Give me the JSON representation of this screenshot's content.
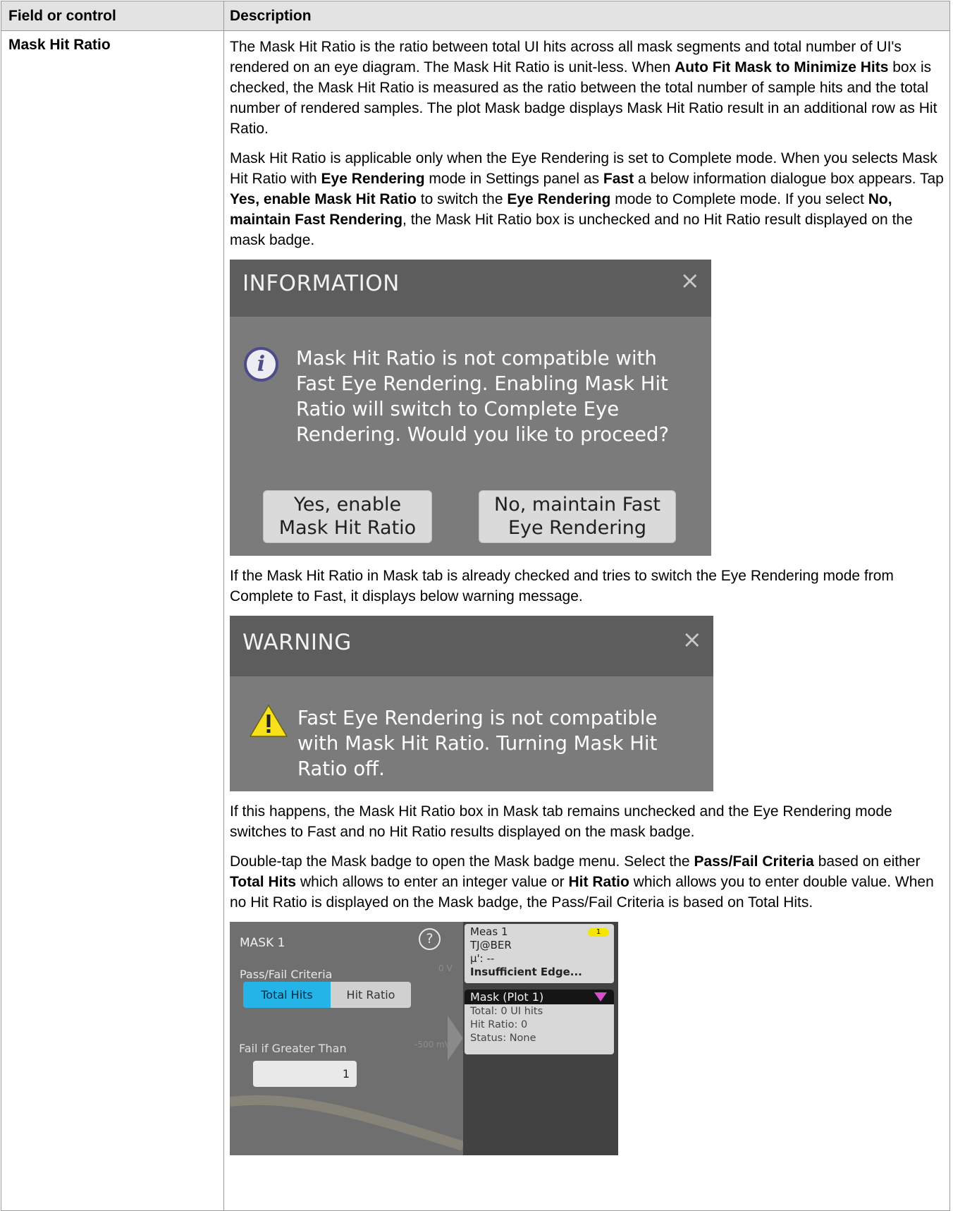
{
  "table": {
    "header_field": "Field or control",
    "header_description": "Description"
  },
  "row": {
    "field": "Mask Hit Ratio",
    "para1": {
      "t1": "The Mask Hit Ratio is the ratio between total UI hits across all mask segments and total number of UI's rendered on an eye diagram. The Mask Hit Ratio is unit-less. When ",
      "b1": "Auto Fit Mask to Minimize Hits",
      "t2": " box is checked, the Mask Hit Ratio is measured as the ratio between the total number of sample hits and the total number of rendered samples. The plot Mask badge displays Mask Hit Ratio result in an additional row as Hit Ratio."
    },
    "para2": {
      "t1": "Mask Hit Ratio is applicable only when the Eye Rendering is set to Complete mode. When you selects Mask Hit Ratio with ",
      "b1": "Eye Rendering",
      "t2": " mode in Settings panel as ",
      "b2": "Fast",
      "t3": " a below information dialogue box appears. Tap ",
      "b3": "Yes, enable Mask Hit Ratio",
      "t4": " to switch the ",
      "b4": "Eye Rendering",
      "t5": " mode to Complete mode. If you select ",
      "b5": "No, maintain Fast Rendering",
      "t6": ", the Mask Hit Ratio box is unchecked and no Hit Ratio result displayed on the mask badge."
    },
    "info_dialog": {
      "title": "INFORMATION",
      "close": "×",
      "icon": "info-icon",
      "message": "Mask Hit Ratio is not compatible with Fast Eye Rendering. Enabling Mask Hit Ratio will switch to Complete Eye Rendering. Would you like to proceed?",
      "yes_line1": "Yes, enable",
      "yes_line2": "Mask Hit Ratio",
      "no_line1": "No, maintain Fast",
      "no_line2": "Eye Rendering"
    },
    "para3": "If the Mask Hit Ratio in Mask tab is already checked and tries to switch the Eye Rendering mode from Complete to Fast, it displays below warning message.",
    "warning_dialog": {
      "title": "WARNING",
      "close": "×",
      "icon": "warning-icon",
      "message": "Fast Eye Rendering is not compatible with Mask Hit Ratio. Turning Mask Hit Ratio off."
    },
    "para4": "If this happens, the Mask Hit Ratio box in Mask tab remains unchecked and the Eye Rendering mode switches to Fast and no Hit Ratio results displayed on the mask badge.",
    "para5": {
      "t1": "Double-tap the Mask badge to open the Mask badge menu. Select the ",
      "b1": "Pass/Fail Criteria",
      "t2": " based on either ",
      "b2": "Total Hits",
      "t3": " which allows to enter an integer value or ",
      "b3": "Hit Ratio",
      "t4": " which allows you to enter double value. When no Hit Ratio is displayed on the Mask badge, the Pass/Fail Criteria is based on Total Hits."
    },
    "mask_menu": {
      "title": "MASK 1",
      "help": "?",
      "pass_fail_label": "Pass/Fail Criteria",
      "option_total": "Total Hits",
      "option_ratio": "Hit Ratio",
      "selected": "Total Hits",
      "fail_label": "Fail if Greater Than",
      "fail_value": "1",
      "faint_top": "0 V",
      "faint_mid": "-500 mV",
      "colors": {
        "selected_bg": "#25b4e8",
        "panel_bg": "#6f6f6f",
        "badge_bg": "#d8d8d8"
      }
    },
    "meas_badge": {
      "title": "Meas 1",
      "tag": "1",
      "line1": "TJ@BER",
      "line2": "μ': --",
      "line3": "Insufficient Edge..."
    },
    "mask_badge": {
      "title": "Mask (Plot 1)",
      "line1": "Total: 0 UI hits",
      "line2": "Hit Ratio: 0",
      "line3": "Status: None",
      "marker_color": "#d74ec9"
    }
  }
}
